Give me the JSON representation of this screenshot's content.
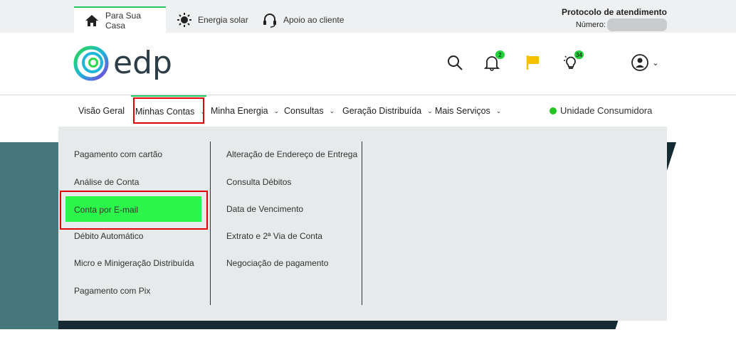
{
  "topbar": {
    "tabs": [
      {
        "label": "Para Sua Casa",
        "icon": "house-icon",
        "active": true
      },
      {
        "label": "Energia solar",
        "icon": "sun-icon",
        "active": false
      },
      {
        "label": "Apoio ao cliente",
        "icon": "headset-icon",
        "active": false
      }
    ],
    "protocol_title": "Protocolo de atendimento",
    "protocol_number_label": "Número:"
  },
  "header": {
    "logo_text": "edp",
    "icons": {
      "search": "search-icon",
      "notifications": {
        "icon": "bell-icon",
        "badge": "2"
      },
      "flag": {
        "icon": "flag-icon",
        "color": "#f5c000"
      },
      "lightbulb": {
        "icon": "lightbulb-icon",
        "badge": "34"
      },
      "account": {
        "icon": "user-circle-icon"
      }
    }
  },
  "nav": {
    "items": [
      {
        "label": "Visão Geral",
        "has_chevron": false
      },
      {
        "label": "Minhas Contas",
        "has_chevron": true,
        "active": true
      },
      {
        "label": "Minha Energia",
        "has_chevron": true
      },
      {
        "label": "Consultas",
        "has_chevron": true
      },
      {
        "label": "Geração Distribuída",
        "has_chevron": true
      },
      {
        "label": "Mais Serviços",
        "has_chevron": true
      }
    ],
    "unit_label": "Unidade Consumidora",
    "unit_status_color": "#22c51f"
  },
  "dropdown": {
    "col1": [
      "Pagamento com cartão",
      "Análise de Conta",
      "Conta por E-mail",
      "Débito Automático",
      "Micro e Minigeração Distribuída",
      "Pagamento com Pix"
    ],
    "col2": [
      "Alteração de Endereço de Entrega",
      "Consulta Débitos",
      "Data de Vencimento",
      "Extrato e 2ª Via de Conta",
      "Negociação de pagamento"
    ],
    "highlighted_item": "Conta por E-mail",
    "highlight_color": "#2cf64a"
  },
  "colors": {
    "accent": "#22c55e",
    "annotation_red": "#e00000",
    "logo_text": "#2d3e48"
  }
}
